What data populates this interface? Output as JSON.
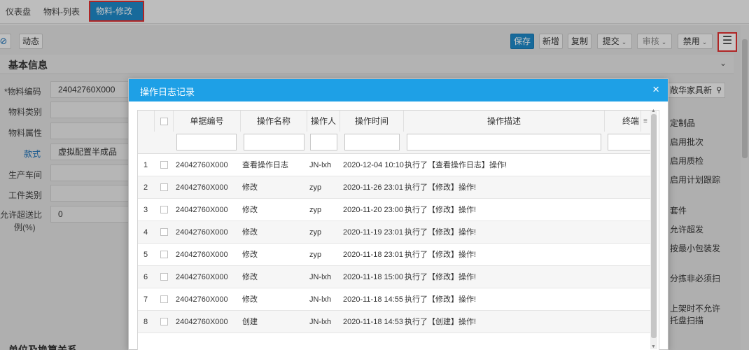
{
  "tabs": [
    {
      "label": "仪表盘"
    },
    {
      "label": "物料-列表"
    },
    {
      "label": "物料-修改",
      "close": "✖"
    }
  ],
  "toolbar": {
    "dynamic_label": "动态",
    "save_label": "保存",
    "add_label": "新增",
    "copy_label": "复制",
    "submit_label": "提交",
    "review_label": "审核",
    "disable_label": "禁用",
    "menu_icon": "☰"
  },
  "section": {
    "title": "基本信息",
    "toggle": "⌄"
  },
  "form": {
    "code_label": "*物料编码",
    "code_value": "24042760X000",
    "category_label": "物料类别",
    "attr_label": "物料属性",
    "style_label": "款式",
    "style_value": "虚拟配置半成品",
    "workshop_label": "生产车间",
    "worktype_label": "工件类别",
    "over_label_1": "允许超送比",
    "over_label_2": "例(%)",
    "over_value": "0"
  },
  "right_col": {
    "search_value": "敞华家具新",
    "items": [
      "定制品",
      "启用批次",
      "启用质检",
      "启用计划跟踪",
      "套件",
      "允许超发",
      "按最小包装发",
      "分拣非必须扫",
      "上架时不允许",
      "托盘扫描"
    ]
  },
  "section2": {
    "title": "单位及换算关系"
  },
  "modal": {
    "title": "操作日志记录",
    "close": "×",
    "columns": [
      "单据编号",
      "操作名称",
      "操作人",
      "操作时间",
      "操作描述",
      "终端"
    ],
    "menu_icon": "≡",
    "rows": [
      {
        "no": "1",
        "code": "24042760X000",
        "op": "查看操作日志",
        "user": "JN-lxh",
        "time": "2020-12-04 10:10",
        "desc": "执行了【查看操作日志】操作!"
      },
      {
        "no": "2",
        "code": "24042760X000",
        "op": "修改",
        "user": "zyp",
        "time": "2020-11-26 23:01",
        "desc": "执行了【修改】操作!"
      },
      {
        "no": "3",
        "code": "24042760X000",
        "op": "修改",
        "user": "zyp",
        "time": "2020-11-20 23:00",
        "desc": "执行了【修改】操作!"
      },
      {
        "no": "4",
        "code": "24042760X000",
        "op": "修改",
        "user": "zyp",
        "time": "2020-11-19 23:01",
        "desc": "执行了【修改】操作!"
      },
      {
        "no": "5",
        "code": "24042760X000",
        "op": "修改",
        "user": "zyp",
        "time": "2020-11-18 23:01",
        "desc": "执行了【修改】操作!"
      },
      {
        "no": "6",
        "code": "24042760X000",
        "op": "修改",
        "user": "JN-lxh",
        "time": "2020-11-18 15:00",
        "desc": "执行了【修改】操作!"
      },
      {
        "no": "7",
        "code": "24042760X000",
        "op": "修改",
        "user": "JN-lxh",
        "time": "2020-11-18 14:55",
        "desc": "执行了【修改】操作!"
      },
      {
        "no": "8",
        "code": "24042760X000",
        "op": "创建",
        "user": "JN-lxh",
        "time": "2020-11-18 14:53",
        "desc": "执行了【创建】操作!"
      }
    ]
  }
}
